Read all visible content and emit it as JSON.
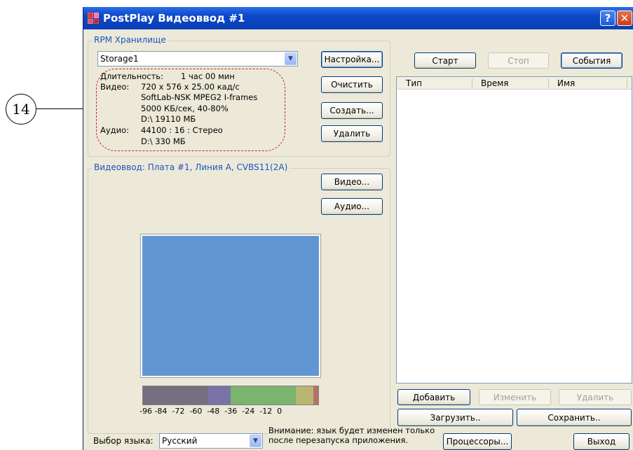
{
  "callout": {
    "number": "14"
  },
  "window": {
    "title": "PostPlay Видеоввод #1",
    "help_label": "?",
    "close_label": "✕"
  },
  "storage_group": {
    "legend": "RPM Хранилище",
    "storage_value": "Storage1",
    "buttons": {
      "setup": "Настройка...",
      "clear": "Очистить",
      "create": "Создать...",
      "delete": "Удалить"
    },
    "info": {
      "duration_label": "Длительность:",
      "duration_value": "1 час 00 мин",
      "video_label": "Видео:",
      "video_lines": [
        "720 x 576 x 25.00 кад/с",
        "SoftLab-NSK MPEG2 I-frames",
        "5000 КБ/сек, 40-80%",
        "D:\\ 19110 МБ"
      ],
      "audio_label": "Аудио:",
      "audio_lines": [
        "44100 : 16 : Стерео",
        "D:\\ 330 МБ"
      ]
    }
  },
  "video_group": {
    "legend": "Видеоввод: Плата #1, Линия A, CVBS11(2A)",
    "buttons": {
      "video": "Видео...",
      "audio": "Аудио..."
    },
    "meter_ticks": "-96 -84  -72  -60  -48  -36  -24  -12  0",
    "meter_colors": [
      "#757081",
      "#7a73a8",
      "#7ab46d",
      "#b9b672",
      "#b9706a"
    ]
  },
  "controls": {
    "start": "Старт",
    "stop": "Стоп",
    "events": "События"
  },
  "events_list": {
    "columns": [
      "Тип",
      "Время",
      "Имя"
    ]
  },
  "list_buttons": {
    "add": "Добавить",
    "edit": "Изменить",
    "delete": "Удалить",
    "load": "Загрузить..",
    "save": "Сохранить.."
  },
  "bottom": {
    "language_label": "Выбор языка:",
    "language_value": "Русский",
    "notice_line1": "Внимание: язык будет изменен только",
    "notice_line2": "после перезапуска приложения.",
    "processors": "Процессоры...",
    "exit": "Выход"
  }
}
